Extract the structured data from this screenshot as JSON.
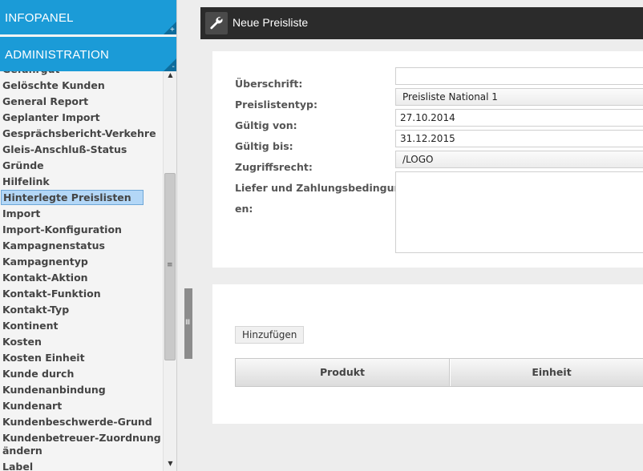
{
  "sidebar": {
    "infopanel_label": "INFOPANEL",
    "infopanel_toggle": "+",
    "administration_label": "ADMINISTRATION",
    "administration_toggle": "-",
    "items": [
      {
        "label": "Gefahrgut"
      },
      {
        "label": "Gelöschte Kunden"
      },
      {
        "label": "General Report"
      },
      {
        "label": "Geplanter Import"
      },
      {
        "label": "Gesprächsbericht-Verkehre"
      },
      {
        "label": "Gleis-Anschluß-Status"
      },
      {
        "label": "Gründe"
      },
      {
        "label": "Hilfelink"
      },
      {
        "label": "Hinterlegte Preislisten"
      },
      {
        "label": "Import"
      },
      {
        "label": "Import-Konfiguration"
      },
      {
        "label": "Kampagnenstatus"
      },
      {
        "label": "Kampagnentyp"
      },
      {
        "label": "Kontakt-Aktion"
      },
      {
        "label": "Kontakt-Funktion"
      },
      {
        "label": "Kontakt-Typ"
      },
      {
        "label": "Kontinent"
      },
      {
        "label": "Kosten"
      },
      {
        "label": "Kosten Einheit"
      },
      {
        "label": "Kunde durch"
      },
      {
        "label": "Kundenanbindung"
      },
      {
        "label": "Kundenart"
      },
      {
        "label": "Kundenbeschwerde-Grund"
      },
      {
        "label": "Kundenbetreuer-Zuordnung ändern"
      },
      {
        "label": "Label"
      }
    ],
    "selected_item": "Hinterlegte Preislisten"
  },
  "main": {
    "title": "Neue Preisliste",
    "title_icon": "wrench-icon",
    "form": {
      "ueberschrift_label": "Überschrift:",
      "ueberschrift_value": "",
      "preislistentyp_label": "Preislistentyp:",
      "preislistentyp_value": "Preisliste National 1",
      "gueltig_von_label": "Gültig von:",
      "gueltig_von_value": "27.10.2014",
      "gueltig_bis_label": "Gültig bis:",
      "gueltig_bis_value": "31.12.2015",
      "zugriffsrecht_label": "Zugriffsrecht:",
      "zugriffsrecht_value": "/LOGO",
      "bedingung_label_line1": "Liefer und Zahlungsbedingung",
      "bedingung_label_line2": "en:",
      "bedingung_value": ""
    },
    "add_button_label": "Hinzufügen",
    "table_headers": [
      "Produkt",
      "Einheit"
    ]
  },
  "colors": {
    "sidebar_header": "#1b9bd7",
    "title_bar": "#2b2b2b",
    "selected_item_bg": "#b3d7f7"
  }
}
